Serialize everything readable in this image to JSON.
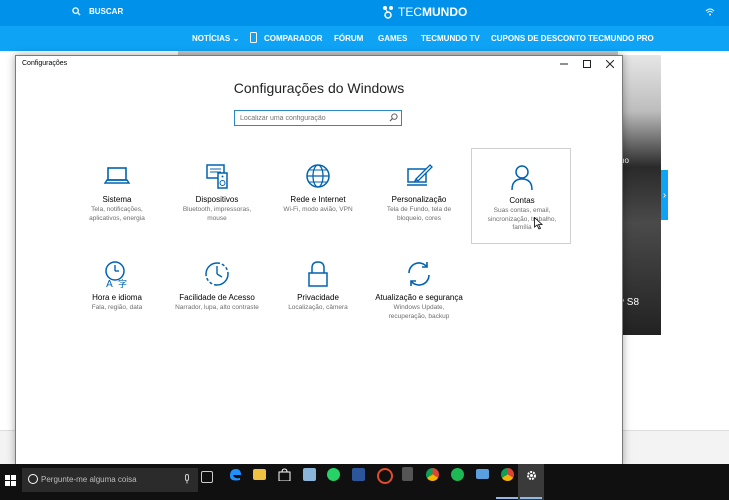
{
  "site": {
    "search_label": "BUSCAR",
    "logo_prefix": "TEC",
    "logo_suffix": "MUNDO",
    "nav": [
      "NOTÍCIAS",
      "COMPARADOR",
      "FÓRUM",
      "GAMES",
      "TECMUNDO TV",
      "CUPONS DE DESCONTO",
      "TECMUNDO PRO"
    ],
    "side_text_1": "no",
    "side_text_2": "y S8",
    "accent": "#0091ea"
  },
  "window": {
    "title": "Configurações",
    "minimize_icon": "minimize-icon",
    "maximize_icon": "maximize-icon",
    "close_icon": "close-icon"
  },
  "main": {
    "heading": "Configurações do Windows",
    "search_placeholder": "Localizar uma configuração",
    "accent": "#0063b1",
    "tiles": [
      {
        "label": "Sistema",
        "desc": "Tela, notificações, aplicativos, energia",
        "icon": "laptop-icon"
      },
      {
        "label": "Dispositivos",
        "desc": "Bluetooth, impressoras, mouse",
        "icon": "devices-icon"
      },
      {
        "label": "Rede e Internet",
        "desc": "Wi-Fi, modo avião, VPN",
        "icon": "globe-icon"
      },
      {
        "label": "Personalização",
        "desc": "Tela de Fundo, tela de bloqueio, cores",
        "icon": "paint-icon"
      },
      {
        "label": "Contas",
        "desc": "Suas contas, email, sincronização, trabalho, família",
        "icon": "person-icon"
      },
      {
        "label": "Hora e idioma",
        "desc": "Fala, região, data",
        "icon": "clock-language-icon"
      },
      {
        "label": "Facilidade de Acesso",
        "desc": "Narrador, lupa, alto contraste",
        "icon": "ease-access-icon"
      },
      {
        "label": "Privacidade",
        "desc": "Localização, câmera",
        "icon": "lock-icon"
      },
      {
        "label": "Atualização e segurança",
        "desc": "Windows Update, recuperação, backup",
        "icon": "update-icon"
      }
    ]
  },
  "taskbar": {
    "search_placeholder": "Pergunte-me alguma coisa",
    "apps": [
      "task-view-icon",
      "edge-icon",
      "file-explorer-icon",
      "store-icon",
      "app-icon",
      "whatsapp-icon",
      "word-icon",
      "app-icon",
      "calculator-icon",
      "chrome-icon",
      "spotify-icon",
      "mail-icon",
      "chrome-icon",
      "settings-icon"
    ]
  }
}
